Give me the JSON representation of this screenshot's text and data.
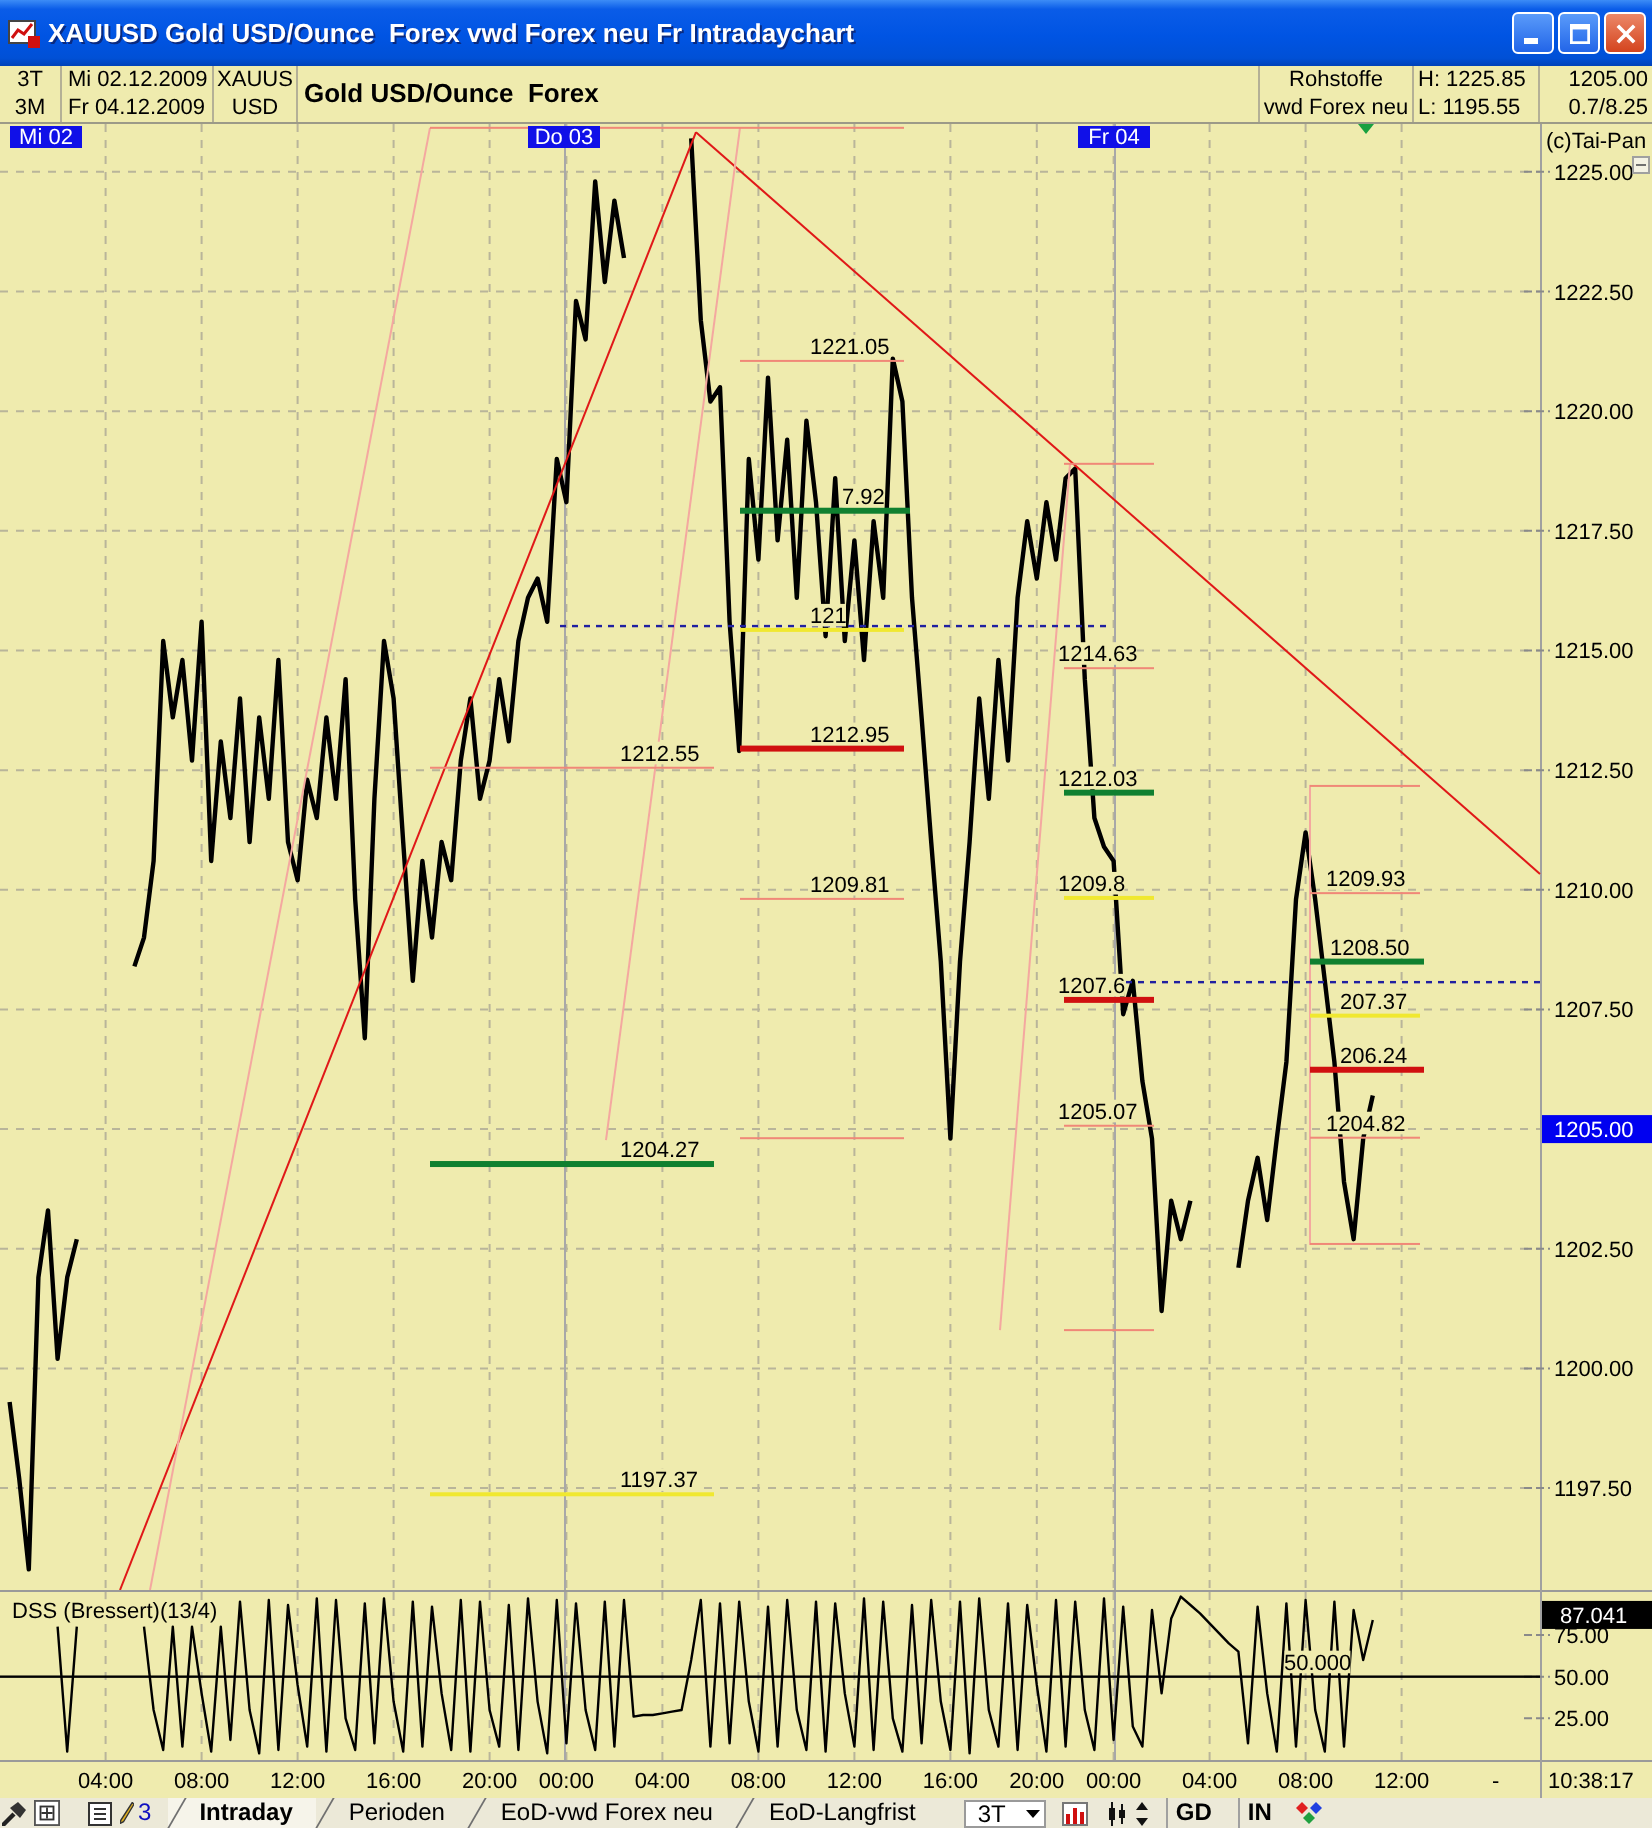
{
  "window": {
    "title": "XAUUSD Gold USD/Ounce  Forex vwd Forex neu Fr Intradaychart"
  },
  "header": {
    "periods": [
      "3T",
      "3M"
    ],
    "dates": [
      "Mi 02.12.2009",
      "Fr 04.12.2009"
    ],
    "symbol": [
      "XAUUS",
      "USD"
    ],
    "name": "Gold USD/Ounce  Forex",
    "category": [
      "Rohstoffe",
      "vwd Forex neu"
    ],
    "range": [
      "H: 1225.85",
      "L: 1195.55"
    ],
    "quote": [
      "1205.00",
      "0.7/8.25"
    ]
  },
  "chart": {
    "copyright": "(c)Tai-Pan",
    "day_labels": [
      "Mi 02",
      "Do 03",
      "Fr 04"
    ],
    "last_price": "1205.00",
    "trend_lines": [
      {
        "kind": "solid",
        "color": "#e01818"
      },
      {
        "kind": "solid",
        "color": "#e01818"
      },
      {
        "kind": "solid",
        "color": "#f4a8a0"
      },
      {
        "kind": "solid",
        "color": "#f4a8a0"
      },
      {
        "kind": "solid",
        "color": "#f4a8a0"
      },
      {
        "kind": "solid",
        "color": "#f4a8a0"
      },
      {
        "kind": "dashed",
        "color": "#2020a0"
      },
      {
        "kind": "dashed",
        "color": "#2020a0"
      }
    ],
    "levels": [
      {
        "kind": "thin",
        "color": "#f08878"
      },
      {
        "kind": "thin",
        "color": "#f08878",
        "label": "1212.55"
      },
      {
        "kind": "thick",
        "color": "#108030",
        "label": "1204.27"
      },
      {
        "kind": "medium",
        "color": "#f0e830",
        "label": "1197.37"
      },
      {
        "kind": "thin",
        "color": "#f08878",
        "label": "1221.05"
      },
      {
        "kind": "thick",
        "color": "#108030",
        "label": "7.92"
      },
      {
        "kind": "medium",
        "color": "#f0e830",
        "label": "121"
      },
      {
        "kind": "thick",
        "color": "#d01010",
        "label": "1212.95"
      },
      {
        "kind": "thin",
        "color": "#f08878",
        "label": "1209.81"
      },
      {
        "kind": "thin",
        "color": "#f08878"
      },
      {
        "kind": "thin",
        "color": "#f08878"
      },
      {
        "kind": "thin",
        "color": "#f08878",
        "label": "1214.63"
      },
      {
        "kind": "thick",
        "color": "#108030",
        "label": "1212.03"
      },
      {
        "kind": "medium",
        "color": "#f0e830",
        "label": "1209.8"
      },
      {
        "kind": "thick",
        "color": "#d01010",
        "label": "1207.6"
      },
      {
        "kind": "thin",
        "color": "#f08878",
        "label": "1205.07"
      },
      {
        "kind": "thin",
        "color": "#f08878"
      },
      {
        "kind": "thin",
        "color": "#f08878"
      },
      {
        "kind": "thin",
        "color": "#f08878",
        "label": "1209.93"
      },
      {
        "kind": "thick",
        "color": "#108030",
        "label": "1208.50"
      },
      {
        "kind": "medium",
        "color": "#f0e830",
        "label": "207.37"
      },
      {
        "kind": "thick",
        "color": "#d01010",
        "label": "206.24"
      },
      {
        "kind": "thin",
        "color": "#f08878",
        "label": "1204.82"
      },
      {
        "kind": "thin",
        "color": "#f08878"
      }
    ],
    "chart_data": {
      "type": "line",
      "grid": true,
      "values": [
        null,
        1199.3,
        1197.7,
        1195.8,
        1201.9,
        1203.3,
        1200.2,
        1201.9,
        1202.7,
        null,
        null,
        null,
        null,
        null,
        1208.4,
        1209.0,
        1210.6,
        1215.2,
        1213.6,
        1214.8,
        1212.7,
        1215.6,
        1210.6,
        1213.1,
        1211.5,
        1214.0,
        1211.0,
        1213.6,
        1211.9,
        1214.8,
        1211.0,
        1210.2,
        1212.3,
        1211.5,
        1213.6,
        1211.9,
        1214.4,
        1209.8,
        1206.9,
        1211.9,
        1215.2,
        1214.0,
        1211.0,
        1208.1,
        1210.6,
        1209.0,
        1211.0,
        1210.2,
        1212.7,
        1214.0,
        1211.9,
        1212.7,
        1214.4,
        1213.1,
        1215.2,
        1216.1,
        1216.5,
        1215.6,
        1219.0,
        1218.1,
        1222.3,
        1221.5,
        1224.8,
        1222.7,
        1224.4,
        1223.2,
        null,
        null,
        null,
        null,
        null,
        null,
        1225.7,
        1221.9,
        1220.2,
        1220.5,
        1215.6,
        1212.9,
        1219.0,
        1216.9,
        1220.7,
        1217.3,
        1219.4,
        1216.1,
        1219.8,
        1218.1,
        1215.3,
        1218.6,
        1215.2,
        1217.3,
        1214.8,
        1217.7,
        1216.1,
        1221.1,
        1220.2,
        1216.1,
        1213.6,
        1211.0,
        1208.5,
        1204.8,
        1208.5,
        1211.0,
        1214.0,
        1211.9,
        1214.8,
        1212.7,
        1216.1,
        1217.7,
        1216.5,
        1218.1,
        1216.9,
        1218.6,
        1218.8,
        1214.4,
        1211.5,
        1210.9,
        1210.6,
        1207.4,
        1208.1,
        1206.0,
        1204.8,
        1201.2,
        1203.5,
        1202.7,
        1203.5,
        null,
        null,
        null,
        null,
        1202.1,
        1203.5,
        1204.4,
        1203.1,
        1204.8,
        1206.4,
        1209.8,
        1211.2,
        1209.8,
        1208.1,
        1206.4,
        1203.9,
        1202.7,
        1204.8,
        1205.7,
        null,
        null,
        null,
        null,
        null,
        null,
        null,
        null,
        null,
        null,
        null,
        null,
        null,
        null,
        null,
        null,
        null
      ],
      "ylim": [
        1195.37,
        1226
      ],
      "yticks": [
        {
          "value": 1197.5,
          "label": "1197.50"
        },
        {
          "value": 1200,
          "label": "1200.00"
        },
        {
          "value": 1202.5,
          "label": "1202.50"
        },
        {
          "value": 1207.5,
          "label": "1207.50"
        },
        {
          "value": 1210,
          "label": "1210.00"
        },
        {
          "value": 1212.5,
          "label": "1212.50"
        },
        {
          "value": 1215,
          "label": "1215.00"
        },
        {
          "value": 1217.5,
          "label": "1217.50"
        },
        {
          "value": 1220,
          "label": "1220.00"
        },
        {
          "value": 1222.5,
          "label": "1222.50"
        },
        {
          "value": 1225,
          "label": "1225.00"
        }
      ]
    }
  },
  "oscillator": {
    "reference_label": "50.000",
    "last_value": "87.041",
    "chart_data": {
      "type": "line",
      "title": "DSS (Bressert)(13/4)",
      "grid": true,
      "categories": [
        null,
        null,
        null,
        null,
        null,
        null,
        null,
        null,
        null,
        null,
        null,
        "04:00",
        null,
        null,
        null,
        null,
        null,
        null,
        null,
        null,
        null,
        "08:00",
        null,
        null,
        null,
        null,
        null,
        null,
        null,
        null,
        null,
        "12:00",
        null,
        null,
        null,
        null,
        null,
        null,
        null,
        null,
        null,
        "16:00",
        null,
        null,
        null,
        null,
        null,
        null,
        null,
        null,
        null,
        "20:00",
        null,
        null,
        null,
        null,
        null,
        null,
        null,
        "00:00",
        null,
        null,
        null,
        null,
        null,
        null,
        null,
        null,
        null,
        "04:00",
        null,
        null,
        null,
        null,
        null,
        null,
        null,
        null,
        null,
        "08:00",
        null,
        null,
        null,
        null,
        null,
        null,
        null,
        null,
        null,
        "12:00",
        null,
        null,
        null,
        null,
        null,
        null,
        null,
        null,
        null,
        "16:00",
        null,
        null,
        null,
        null,
        null,
        null,
        null,
        null,
        "20:00",
        null,
        null,
        null,
        null,
        null,
        null,
        null,
        "00:00",
        null,
        null,
        null,
        null,
        null,
        null,
        null,
        null,
        null,
        "04:00",
        null,
        null,
        null,
        null,
        null,
        null,
        null,
        null,
        null,
        "08:00",
        null,
        null,
        null,
        null,
        null,
        null,
        null,
        null,
        null,
        "12:00",
        null,
        null,
        null,
        null,
        null,
        null,
        null,
        null,
        null,
        null,
        null,
        null,
        null,
        null
      ],
      "values": [
        null,
        null,
        null,
        null,
        null,
        null,
        80,
        5,
        80,
        null,
        null,
        null,
        null,
        null,
        null,
        80,
        30,
        6,
        80,
        8,
        80,
        40,
        5,
        80,
        12,
        95,
        30,
        4,
        96,
        6,
        93,
        45,
        8,
        97,
        5,
        96,
        25,
        6,
        94,
        10,
        97,
        35,
        5,
        95,
        8,
        92,
        40,
        6,
        96,
        5,
        95,
        30,
        8,
        93,
        6,
        97,
        35,
        4,
        96,
        10,
        94,
        30,
        6,
        95,
        8,
        96,
        26,
        27,
        27,
        28,
        29,
        30,
        60,
        96,
        8,
        94,
        10,
        95,
        35,
        5,
        92,
        8,
        96,
        30,
        6,
        95,
        5,
        94,
        40,
        8,
        97,
        6,
        95,
        25,
        5,
        93,
        10,
        96,
        35,
        6,
        95,
        4,
        97,
        30,
        8,
        94,
        6,
        93,
        45,
        5,
        96,
        8,
        95,
        30,
        6,
        97,
        12,
        92,
        20,
        8,
        90,
        40,
        85,
        98,
        93,
        88,
        82,
        76,
        70,
        65,
        10,
        92,
        40,
        5,
        94,
        8,
        96,
        30,
        5,
        95,
        8,
        90,
        60,
        84,
        null,
        null,
        null,
        null,
        null,
        null,
        null,
        null,
        null,
        null,
        null,
        null,
        null,
        null,
        null,
        null,
        null
      ],
      "ylim": [
        0,
        102
      ],
      "yticks": [
        {
          "value": 75,
          "label": "75.00"
        },
        {
          "value": 50,
          "label": "50.00"
        },
        {
          "value": 25,
          "label": "25.00"
        }
      ]
    }
  },
  "time_axis": {
    "toggle": "-",
    "clock": "10:38:17"
  },
  "toolbar": {
    "tool_count": "3",
    "tabs": [
      {
        "label": "Intraday",
        "selected": true
      },
      {
        "label": "Perioden",
        "selected": false
      },
      {
        "label": "EoD-vwd Forex neu",
        "selected": false
      },
      {
        "label": "EoD-Langfrist",
        "selected": false
      }
    ],
    "interval": "3T",
    "buttons": [
      "GD",
      "IN"
    ]
  }
}
